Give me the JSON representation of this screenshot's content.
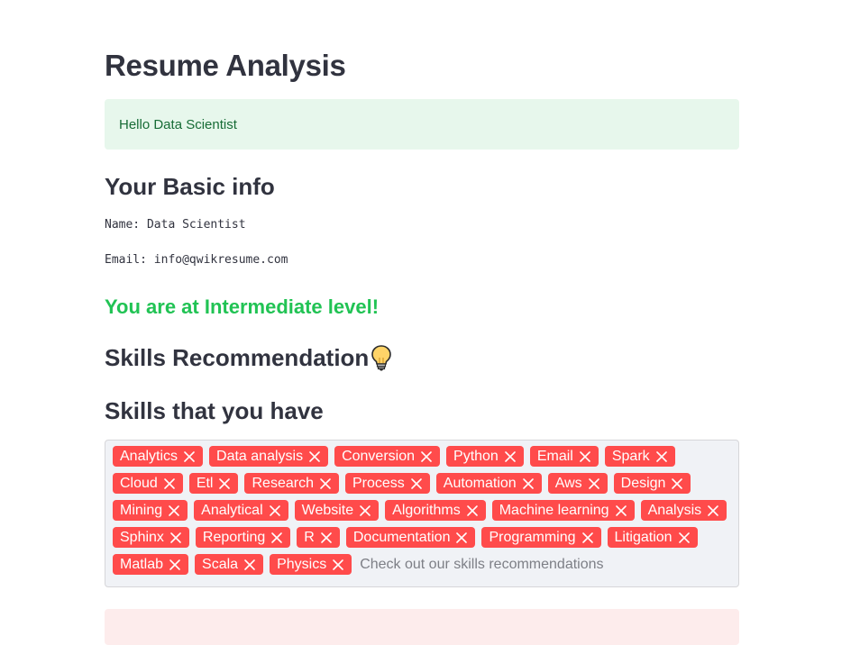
{
  "page": {
    "title": "Resume Analysis",
    "greeting": "Hello Data Scientist"
  },
  "basic_info": {
    "heading": "Your Basic info",
    "name_line": "Name: Data Scientist",
    "email_line": "Email: info@qwikresume.com"
  },
  "level": {
    "text": "You are at Intermediate level!",
    "color": "#21c354"
  },
  "recommendation": {
    "heading": "Skills Recommendation",
    "icon": "lightbulb-icon"
  },
  "skills": {
    "heading": "Skills that you have",
    "placeholder": "Check out our skills recommendations",
    "tag_color": "#ff4b4b",
    "items": [
      "Analytics",
      "Data analysis",
      "Conversion",
      "Python",
      "Email",
      "Spark",
      "Cloud",
      "Etl",
      "Research",
      "Process",
      "Automation",
      "Aws",
      "Design",
      "Mining",
      "Analytical",
      "Website",
      "Algorithms",
      "Machine learning",
      "Analysis",
      "Sphinx",
      "Reporting",
      "R",
      "Documentation",
      "Programming",
      "Litigation",
      "Matlab",
      "Scala",
      "Physics"
    ]
  },
  "colors": {
    "success_bg": "#e7f7ec",
    "success_text": "#176c36",
    "error_bg": "#fdecec"
  }
}
